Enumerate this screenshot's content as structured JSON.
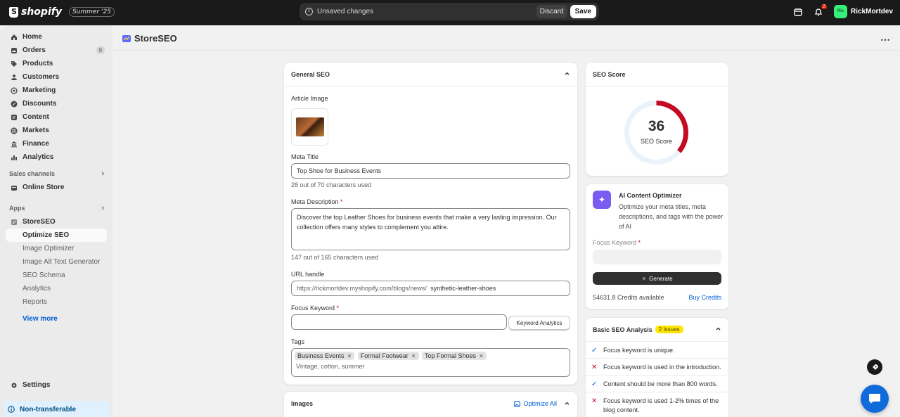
{
  "topbar": {
    "brand": "shopify",
    "edition": "Summer '25",
    "unsaved_text": "Unsaved changes",
    "discard_label": "Discard",
    "save_label": "Save",
    "notification_count": "2",
    "user_initials": "Ric",
    "user_name": "RickMortdev"
  },
  "sidebar": {
    "items": [
      {
        "label": "Home",
        "icon": "home-icon"
      },
      {
        "label": "Orders",
        "icon": "orders-icon",
        "count": "9"
      },
      {
        "label": "Products",
        "icon": "tag-icon"
      },
      {
        "label": "Customers",
        "icon": "person-icon"
      },
      {
        "label": "Marketing",
        "icon": "target-icon"
      },
      {
        "label": "Discounts",
        "icon": "discount-icon"
      },
      {
        "label": "Content",
        "icon": "content-icon"
      },
      {
        "label": "Markets",
        "icon": "globe-icon"
      },
      {
        "label": "Finance",
        "icon": "bank-icon"
      },
      {
        "label": "Analytics",
        "icon": "chart-icon"
      }
    ],
    "sales_channels_label": "Sales channels",
    "online_store_label": "Online Store",
    "apps_label": "Apps",
    "app_name": "StoreSEO",
    "app_subitems": [
      "Optimize SEO",
      "Image Optimizer",
      "Image Alt Text Generator",
      "SEO Schema",
      "Analytics",
      "Reports"
    ],
    "view_more": "View more",
    "settings_label": "Settings",
    "non_transferable": "Non-transferable"
  },
  "page": {
    "title": "StoreSEO",
    "more": "⋯"
  },
  "general_seo": {
    "heading": "General SEO",
    "article_image_label": "Article Image",
    "meta_title_label": "Meta Title",
    "meta_title_value": "Top Shoe for Business Events",
    "meta_title_help": "28 out of 70 characters used",
    "meta_desc_label": "Meta Description",
    "meta_desc_value": "Discover the top Leather Shoes for business events that make a very lasting impression. Our collection offers many styles to complement you attire.",
    "meta_desc_help": "147 out of 165 characters used",
    "url_label": "URL handle",
    "url_prefix": "https://rickmortdev.myshopify.com/blogs/news/",
    "url_value": "synthetic-leather-shoes",
    "focus_label": "Focus Keyword",
    "focus_value": "",
    "keyword_analytics": "Keyword Analytics",
    "tags_label": "Tags",
    "tags": [
      "Business Events",
      "Formal Footwear",
      "Top Formal Shoes"
    ],
    "tags_placeholder": "Vintage, cotton, summer",
    "required_mark": "*"
  },
  "images_card": {
    "heading": "Images",
    "optimize_all": "Optimize All"
  },
  "seo_score": {
    "heading": "SEO Score",
    "score": "36",
    "label": "SEO Score",
    "fraction": 0.36,
    "color": "#c70a24"
  },
  "ai_optimizer": {
    "title": "AI Content Optimizer",
    "description": "Optimize your meta titles, meta descriptions, and tags with the power of AI",
    "focus_label": "Focus Keyword",
    "focus_value": "",
    "generate": "Generate",
    "credits": "54631.8 Credits available",
    "buy": "Buy Credits"
  },
  "basic_analysis": {
    "heading": "Basic SEO Analysis",
    "issues_badge": "2 Issues",
    "checks": [
      {
        "text": "Focus keyword is unique.",
        "status": "pass"
      },
      {
        "text": "Focus keyword is used in the introduction.",
        "status": "fail"
      },
      {
        "text": "Content should be more than 800 words.",
        "status": "pass"
      },
      {
        "text": "Focus keyword is used 1-2% times of the blog content.",
        "status": "fail"
      }
    ]
  }
}
